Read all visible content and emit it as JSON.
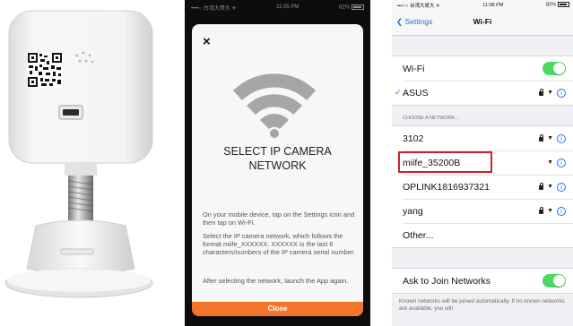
{
  "camera": {
    "description_icon": "camera-photo"
  },
  "middle_phone": {
    "status": {
      "carrier": "••••○ 台湾大哥大 ✈",
      "time": "11:05 PM",
      "battery": "62%"
    },
    "close_symbol": "×",
    "title_line1": "SELECT IP CAMERA",
    "title_line2": "NETWORK",
    "para1": "On your mobile device, tap on the Settings icon and then tap on Wi-Fi.",
    "para2": "Select the IP camera network, which follows the format miife_XXXXXX. XXXXXX is the last 6 characters/numbers of the IP camera serial number.",
    "para3": "After selecting the network, launch the App again.",
    "close_button": "Close",
    "accent_color": "#f1762b"
  },
  "right_phone": {
    "status": {
      "carrier": "•••○○ 台湾大哥大 ✈",
      "time": "11:08 PM",
      "battery": "82%"
    },
    "back_label": "Settings",
    "nav_title": "Wi-Fi",
    "wifi_label": "Wi-Fi",
    "connected_network": "ASUS",
    "section_header": "CHOOSE A NETWORK...",
    "networks": [
      {
        "name": "3102",
        "locked": true
      },
      {
        "name": "miife_35200B",
        "locked": false,
        "highlighted": true
      },
      {
        "name": "OPLINK1816937321",
        "locked": true
      },
      {
        "name": "yang",
        "locked": true
      },
      {
        "name": "Other...",
        "locked": false
      }
    ],
    "ask_label": "Ask to Join Networks",
    "footer": "Known networks will be joined automatically. If no known networks are available, you will",
    "toggle_color": "#4cd964",
    "highlight_color": "#d41f26"
  }
}
